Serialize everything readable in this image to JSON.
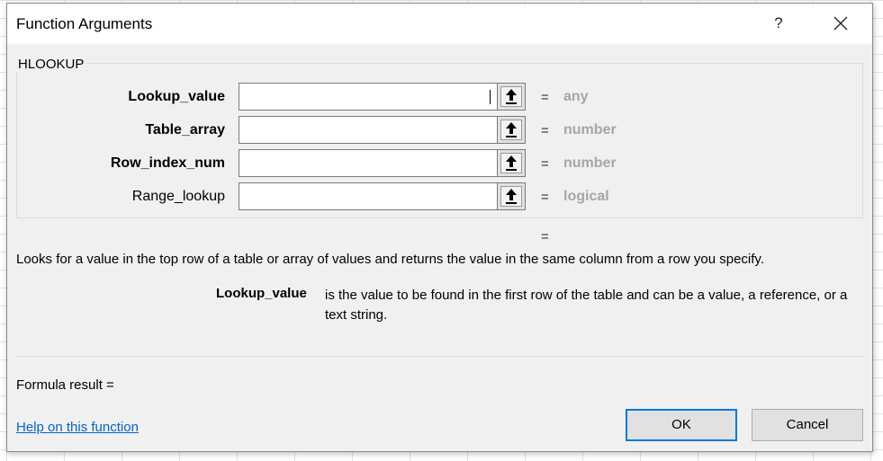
{
  "window": {
    "title": "Function Arguments",
    "help_glyph": "?",
    "close_icon": "close-icon"
  },
  "function": {
    "name": "HLOOKUP",
    "arguments": [
      {
        "label": "Lookup_value",
        "required": true,
        "value": "",
        "result": "any"
      },
      {
        "label": "Table_array",
        "required": true,
        "value": "",
        "result": "number"
      },
      {
        "label": "Row_index_num",
        "required": true,
        "value": "",
        "result": "number"
      },
      {
        "label": "Range_lookup",
        "required": false,
        "value": "",
        "result": "logical"
      }
    ],
    "equals_sign": "=",
    "result_equals": "=",
    "description": "Looks for a value in the top row of a table or array of values and returns the value in the same column from a row you specify.",
    "arg_help": {
      "name": "Lookup_value",
      "text": "is the value to be found in the first row of the table and can be a value, a reference, or a text string."
    }
  },
  "footer": {
    "formula_result": "Formula result =",
    "help_link": "Help on this function",
    "ok_label": "OK",
    "cancel_label": "Cancel"
  },
  "colors": {
    "dialog_bg": "#f0f0f0",
    "link": "#0563c1",
    "default_button_border": "#0078d7",
    "value_hint": "#a6a6a6"
  }
}
